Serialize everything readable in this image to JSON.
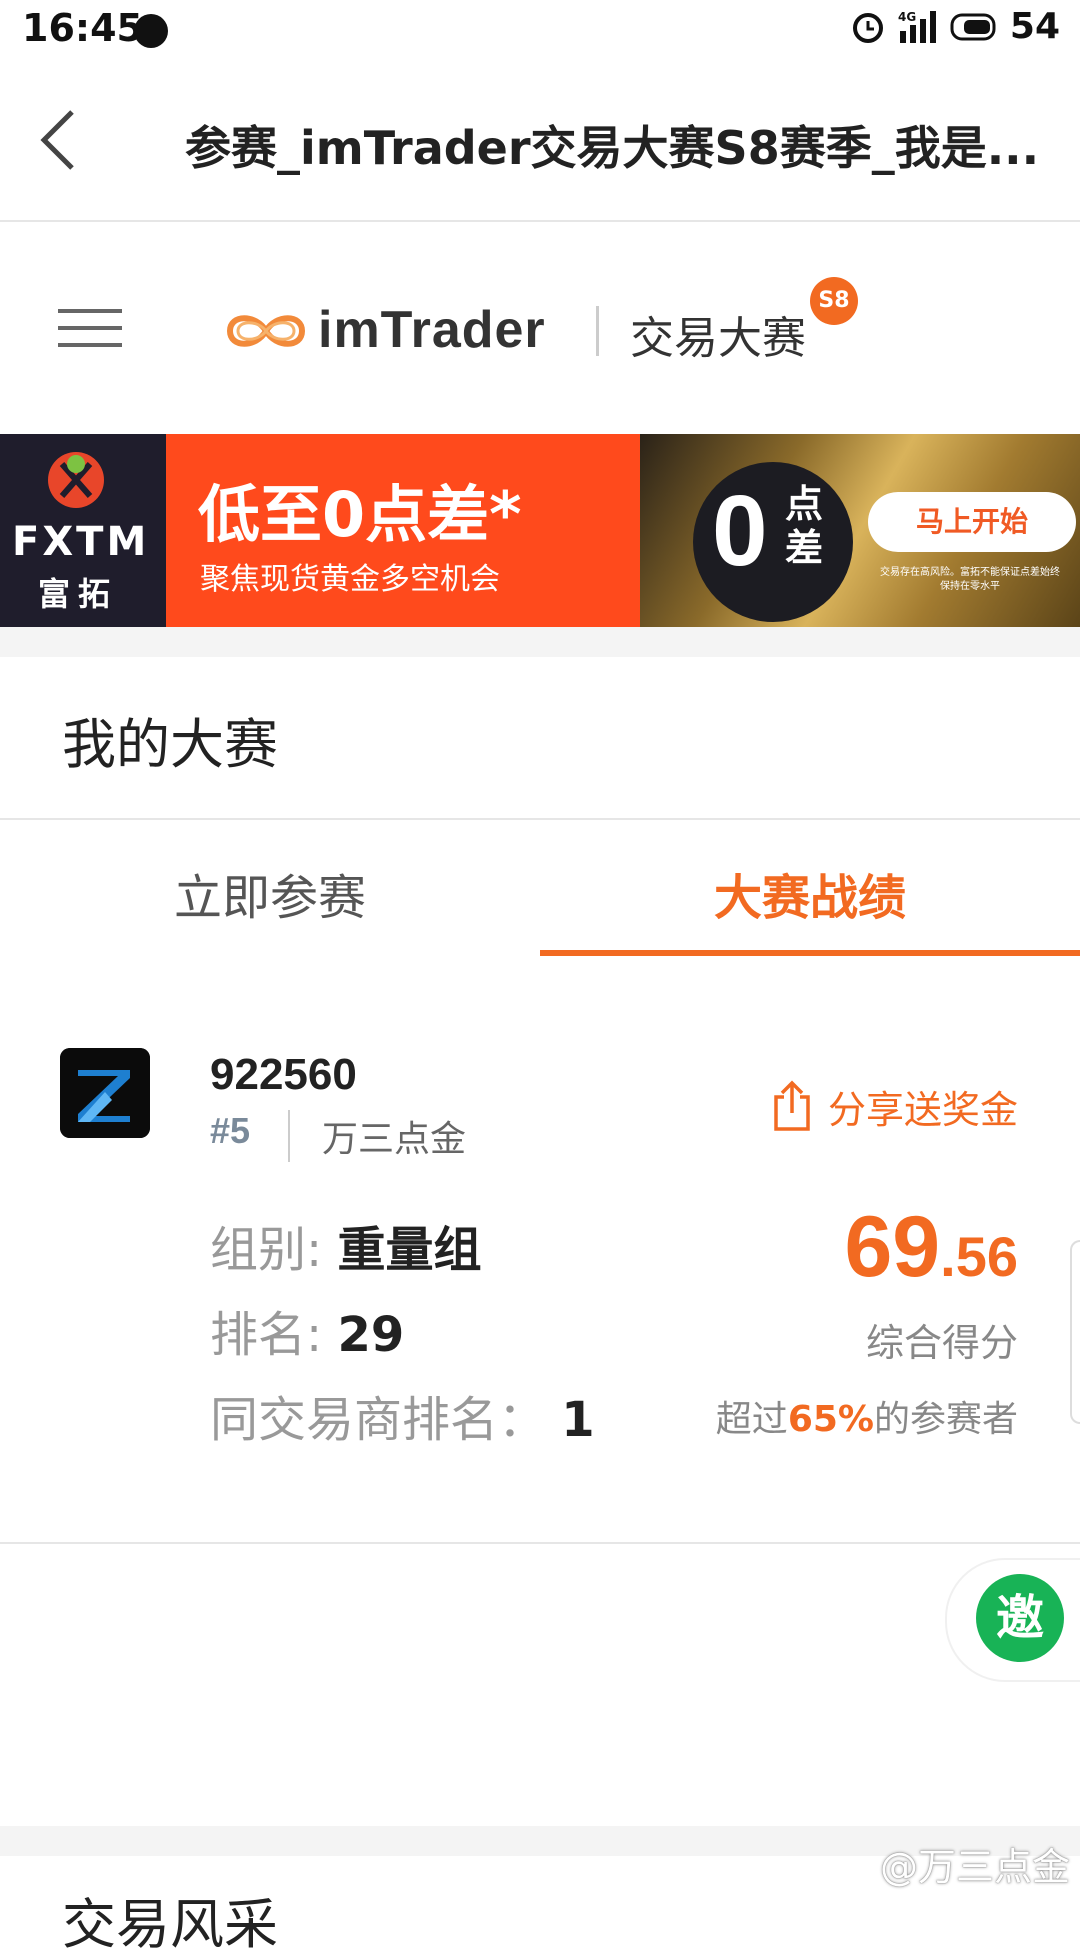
{
  "status_bar": {
    "time": "16:45",
    "network": "4G",
    "battery": "54"
  },
  "nav": {
    "title": "参赛_imTrader交易大赛S8赛季_我是..."
  },
  "header": {
    "logo_text": "imTrader",
    "contest_label": "交易大赛",
    "season_badge": "S8"
  },
  "banner": {
    "brand_en": "FXTM",
    "brand_cn": "富拓",
    "headline": "低至0点差*",
    "subline": "聚焦现货黄金多空机会",
    "zero_number": "0",
    "zero_text": "点差",
    "cta": "马上开始",
    "note": "交易存在高风险。富拓不能保证点差始终保持在零水平"
  },
  "section": {
    "title": "我的大赛"
  },
  "tabs": [
    {
      "label": "立即参赛",
      "active": false
    },
    {
      "label": "大赛战绩",
      "active": true
    }
  ],
  "profile": {
    "user_id": "922560",
    "rank_tag": "#5",
    "nickname": "万三点金",
    "share_label": "分享送奖金",
    "group_label": "组别:",
    "group_value": "重量组",
    "rank_label": "排名:",
    "rank_value": "29",
    "broker_rank_label": "同交易商排名：",
    "broker_rank_value": "1",
    "score_int": "69",
    "score_dec": ".56",
    "score_label": "综合得分",
    "percentile_prefix": "超过",
    "percentile_value": "65%",
    "percentile_suffix": "的参赛者"
  },
  "invite": {
    "label": "邀"
  },
  "next_section": {
    "title": "交易风采"
  },
  "watermark": "@万三点金",
  "colors": {
    "accent": "#f26a21",
    "invite": "#18b356",
    "banner": "#ff4a1c"
  },
  "icons": [
    "back-icon",
    "menu-icon",
    "share-icon",
    "alarm-icon",
    "signal-icon",
    "battery-icon"
  ]
}
